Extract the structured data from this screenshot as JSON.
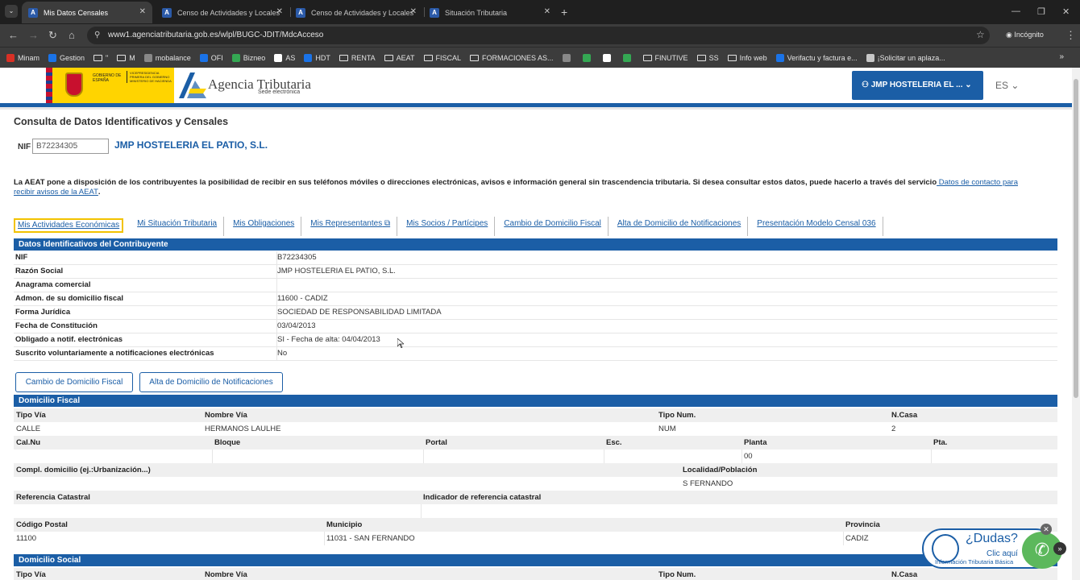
{
  "browser": {
    "tabs": [
      {
        "title": "Mis Datos Censales",
        "active": true
      },
      {
        "title": "Censo de Actividades y Locales",
        "active": false
      },
      {
        "title": "Censo de Actividades y Locales",
        "active": false
      },
      {
        "title": "Situación Tributaria",
        "active": false
      }
    ],
    "url": "www1.agenciatributaria.gob.es/wlpl/BUGC-JDIT/MdcAcceso",
    "incognito_label": "Incógnito",
    "bookmarks": [
      "Minam",
      "Gestion",
      "\"",
      "M",
      "mobalance",
      "OFI",
      "Bizneo",
      "AS",
      "HDT",
      "RENTA",
      "AEAT",
      "FISCAL",
      "FORMACIONES AS...",
      "",
      "",
      "",
      "",
      "FINUTIVE",
      "SS",
      "Info web",
      "Verifactu y factura e...",
      "¡Solicitar un aplaza..."
    ]
  },
  "header": {
    "gob_text": "VICEPRESIDENCIA PRIMERA DEL GOBIERNO",
    "gob_text2": "GOBIERNO DE ESPAÑA",
    "ministry": "MINISTERIO DE HACIENDA",
    "agency": "Agencia Tributaria",
    "agency_sub": "Sede electrónica",
    "user_button": "JMP HOSTELERIA EL ...",
    "lang": "ES"
  },
  "page": {
    "title": "Consulta de Datos Identificativos y Censales",
    "nif_label": "NIF",
    "nif_value": "B72234305",
    "company": "JMP HOSTELERIA EL PATIO, S.L.",
    "notice": "La AEAT pone a disposición de los contribuyentes la posibilidad de recibir en sus teléfonos móviles o direcciones electrónicas, avisos e información general sin trascendencia tributaria. Si desea consultar estos datos, puede hacerlo a través del servicio",
    "notice_link": " Datos de contacto para recibir avisos de la AEAT",
    "notice_end": ".",
    "tabs": [
      "Mis Actividades Económicas",
      "Mi Situación Tributaria",
      "Mis Obligaciones",
      "Mis Representantes",
      "Mis Socios / Partícipes",
      "Cambio de Domicilio Fiscal",
      "Alta de Domicilio de Notificaciones",
      "Presentación Modelo Censal 036"
    ]
  },
  "identificativos": {
    "heading": "Datos Identificativos del Contribuyente",
    "rows": [
      {
        "k": "NIF",
        "v": "B72234305"
      },
      {
        "k": "Razón Social",
        "v": "JMP HOSTELERIA EL PATIO, S.L."
      },
      {
        "k": "Anagrama comercial",
        "v": ""
      },
      {
        "k": "Admon. de su domicilio fiscal",
        "v": "11600 - CADIZ"
      },
      {
        "k": "Forma Jurídica",
        "v": "SOCIEDAD DE RESPONSABILIDAD LIMITADA"
      },
      {
        "k": "Fecha de Constitución",
        "v": "03/04/2013"
      },
      {
        "k": "Obligado a notif. electrónicas",
        "v": "SI - Fecha de alta: 04/04/2013"
      },
      {
        "k": "Suscrito voluntariamente a notificaciones electrónicas",
        "v": "No"
      }
    ]
  },
  "buttons": {
    "cambio": "Cambio de Domicilio Fiscal",
    "alta": "Alta de Domicilio de Notificaciones"
  },
  "fiscal": {
    "heading": "Domicilio Fiscal",
    "h_tipo_via": "Tipo Vía",
    "h_nombre_via": "Nombre Vía",
    "h_tipo_num": "Tipo Num.",
    "h_ncasa": "N.Casa",
    "tipo_via": "CALLE",
    "nombre_via": "HERMANOS LAULHE",
    "tipo_num": "NUM",
    "ncasa": "2",
    "h_calnu": "Cal.Nu",
    "h_bloque": "Bloque",
    "h_portal": "Portal",
    "h_esc": "Esc.",
    "h_planta": "Planta",
    "h_pta": "Pta.",
    "planta": "00",
    "h_compl": "Compl. domicilio (ej.:Urbanización...)",
    "h_localidad": "Localidad/Población",
    "localidad": "S FERNANDO",
    "h_refcat": "Referencia Catastral",
    "h_indref": "Indicador de referencia catastral",
    "h_cp": "Código Postal",
    "h_muni": "Municipio",
    "h_prov": "Provincia",
    "cp": "11100",
    "muni": "11031 - SAN FERNANDO",
    "prov": "CADIZ"
  },
  "social": {
    "heading": "Domicilio Social",
    "h_tipo_via": "Tipo Vía",
    "h_nombre_via": "Nombre Vía",
    "h_tipo_num": "Tipo Num.",
    "h_ncasa": "N.Casa"
  },
  "help": {
    "q": "¿Dudas?",
    "click": "Clic aquí",
    "info": "Información Tributaria Básica"
  }
}
